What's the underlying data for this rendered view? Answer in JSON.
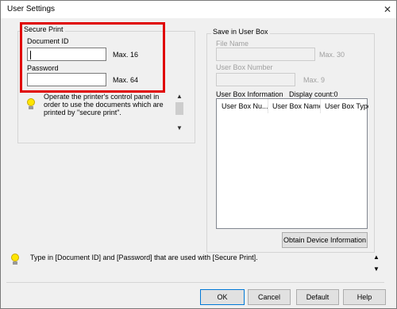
{
  "window": {
    "title": "User Settings",
    "close_glyph": "✕"
  },
  "secure_print": {
    "group_label": "Secure Print",
    "document_id_label": "Document ID",
    "document_id_value": "",
    "document_id_max": "Max. 16",
    "password_label": "Password",
    "password_value": "",
    "password_max": "Max. 64",
    "hint": "Operate the printer's control panel in order to use the documents which are printed by \"secure print\".",
    "hint_icon": "lightbulb-icon"
  },
  "user_box": {
    "group_label": "Save in User Box",
    "file_name_label": "File Name",
    "file_name_max": "Max. 30",
    "box_number_label": "User Box Number",
    "box_number_max": "Max. 9",
    "info_label": "User Box Information",
    "display_count": "Display count:0",
    "columns": [
      "User Box Nu...",
      "User Box Name",
      "User Box Type"
    ],
    "obtain_button": "Obtain Device Information"
  },
  "footer": {
    "message": "Type in [Document ID] and [Password] that are used with [Secure Print].",
    "message_icon": "lightbulb-icon",
    "ok": "OK",
    "cancel": "Cancel",
    "default": "Default",
    "help": "Help"
  },
  "colors": {
    "highlight": "#e00000",
    "accent": "#0078d7",
    "bulb": "#ffe600"
  }
}
